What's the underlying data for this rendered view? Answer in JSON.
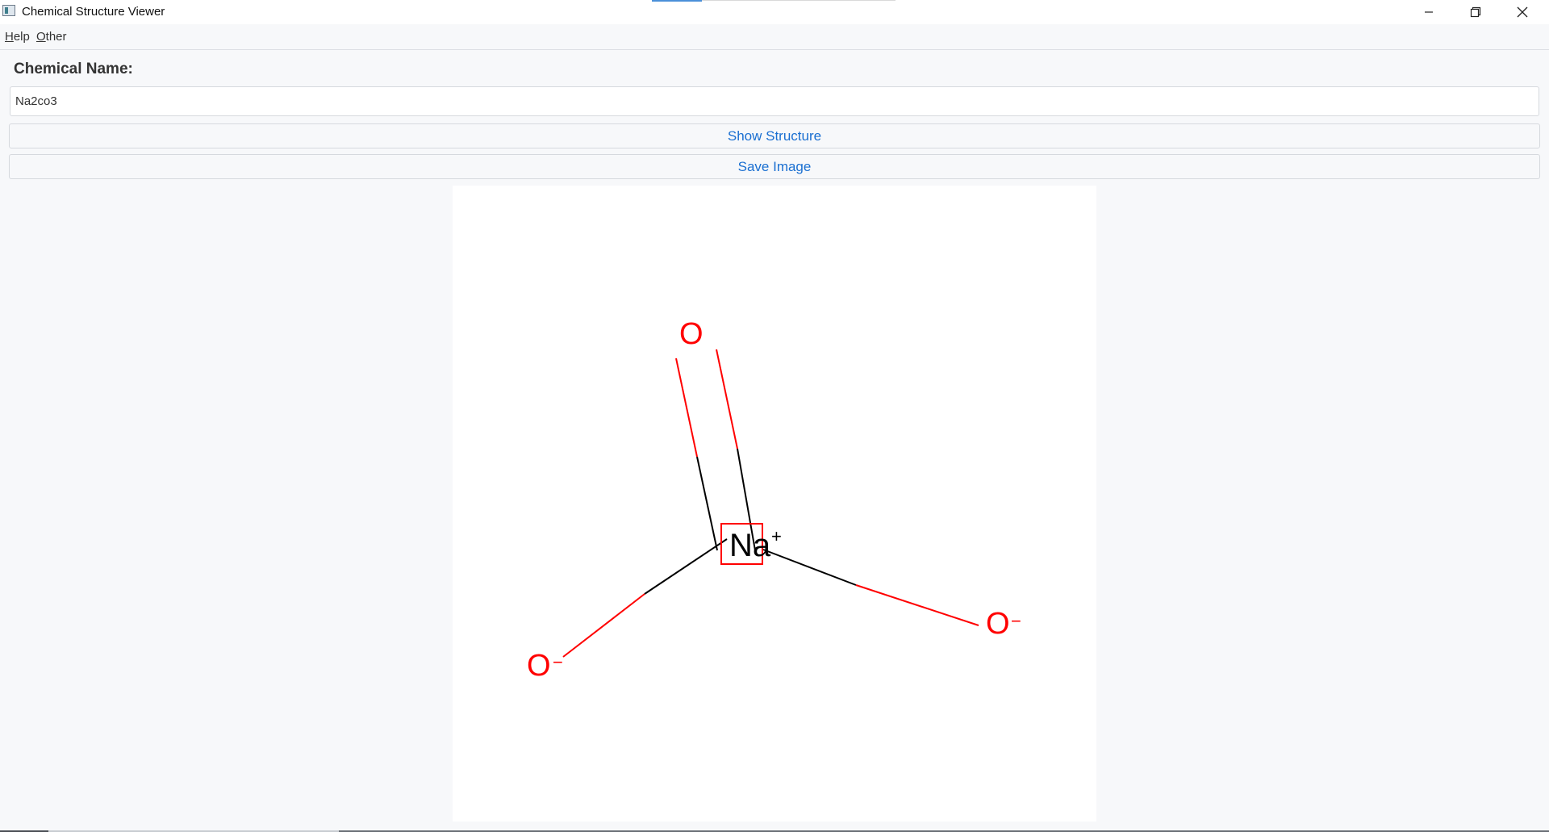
{
  "window": {
    "title": "Chemical Structure Viewer",
    "icons": {
      "app": "app-icon",
      "minimize": "minimize-icon",
      "maximize": "restore-icon",
      "close": "close-icon"
    }
  },
  "menu": {
    "help": {
      "mnemonic": "H",
      "rest": "elp"
    },
    "other": {
      "mnemonic": "O",
      "rest": "ther"
    }
  },
  "form": {
    "label": "Chemical Name:",
    "input_value": "Na2co3",
    "show_button": "Show Structure",
    "save_button": "Save Image"
  },
  "structure": {
    "center_atom": "Na",
    "center_charge": "+",
    "top_atom": "O",
    "left_atom": "O",
    "left_charge": "−",
    "right_atom": "O",
    "right_charge": "−",
    "colors": {
      "oxygen": "#ff0000",
      "sodium": "#000000",
      "bond": "#000000",
      "highlight": "#ff0000"
    }
  }
}
